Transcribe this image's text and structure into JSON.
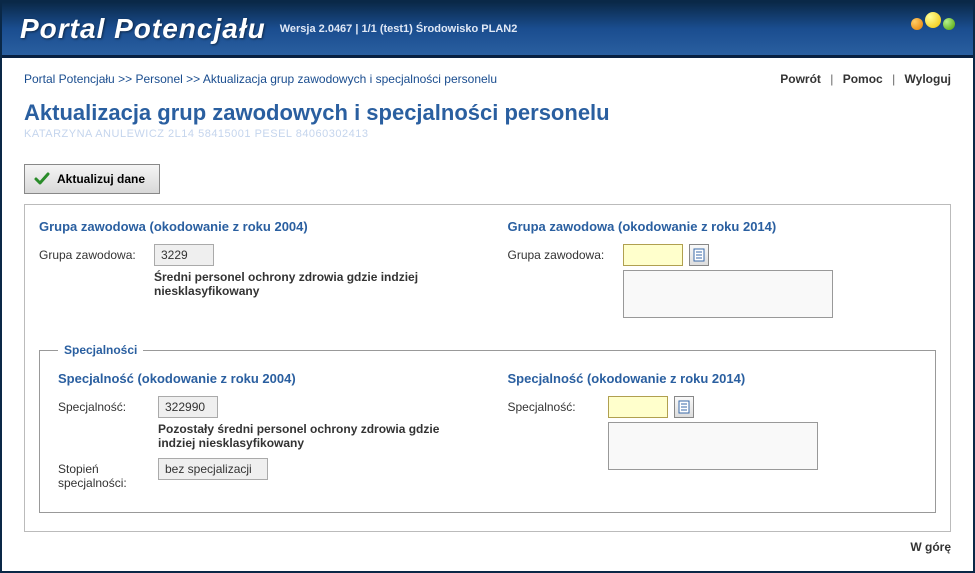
{
  "header": {
    "title": "Portal Potencjału",
    "subtitle": "Wersja 2.0467 | 1/1 (test1) Środowisko PLAN2"
  },
  "breadcrumb": {
    "item1": "Portal Potencjału",
    "sep": " >> ",
    "item2": "Personel",
    "item3": "Aktualizacja grup zawodowych i specjalności personelu"
  },
  "nav": {
    "back": "Powrót",
    "help": "Pomoc",
    "logout": "Wyloguj"
  },
  "page": {
    "title": "Aktualizacja grup zawodowych i specjalności personelu",
    "subtitle": "KATARZYNA ANULEWICZ 2L14 58415001 PESEL 84060302413"
  },
  "button": {
    "update": "Aktualizuj dane"
  },
  "group2004": {
    "heading": "Grupa zawodowa (okodowanie z roku 2004)",
    "label": "Grupa zawodowa:",
    "code": "3229",
    "desc": "Średni personel ochrony zdrowia gdzie indziej niesklasyfikowany"
  },
  "group2014": {
    "heading": "Grupa zawodowa (okodowanie z roku 2014)",
    "label": "Grupa zawodowa:",
    "code": "",
    "desc": ""
  },
  "specFieldset": "Specjalności",
  "spec2004": {
    "heading": "Specjalność (okodowanie z roku 2004)",
    "label": "Specjalność:",
    "code": "322990",
    "desc": "Pozostały średni personel ochrony zdrowia gdzie indziej niesklasyfikowany",
    "degreeLabel": "Stopień specjalności:",
    "degree": "bez specjalizacji"
  },
  "spec2014": {
    "heading": "Specjalność (okodowanie z roku 2014)",
    "label": "Specjalność:",
    "code": "",
    "desc": ""
  },
  "footer": {
    "top": "W górę"
  }
}
